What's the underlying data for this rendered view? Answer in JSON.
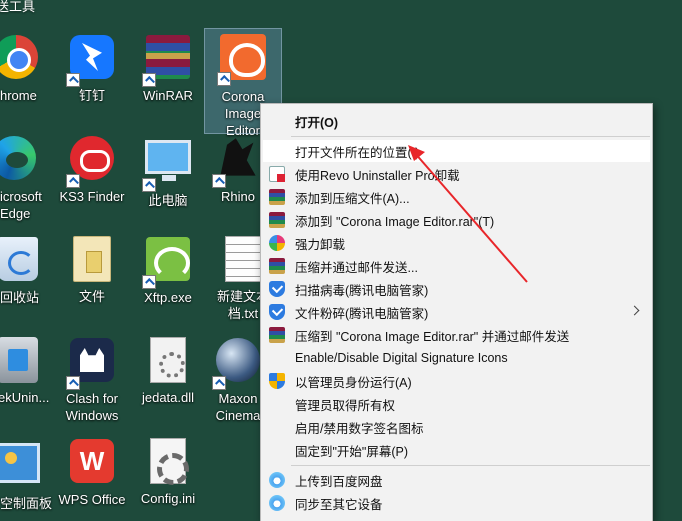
{
  "desktop": {
    "top_strip_label": "送工具",
    "icons": [
      {
        "label": "hrome",
        "icon": "chrome-icon"
      },
      {
        "label": "钉钉",
        "icon": "dingtalk-icon"
      },
      {
        "label": "WinRAR",
        "icon": "winrar-icon"
      },
      {
        "label": "Corona\nImage\nEditor",
        "icon": "corona-image-editor-icon"
      },
      {
        "label": "icrosoft\nEdge",
        "icon": "edge-icon"
      },
      {
        "label": "KS3 Finder",
        "icon": "ks3-finder-icon"
      },
      {
        "label": "此电脑",
        "icon": "this-pc-icon"
      },
      {
        "label": "Rhino",
        "icon": "rhino-icon"
      },
      {
        "label": "回收站",
        "icon": "recycle-bin-icon"
      },
      {
        "label": "文件",
        "icon": "folder-file-icon"
      },
      {
        "label": "Xftp.exe",
        "icon": "xftp-icon"
      },
      {
        "label": "新建文本\n档.txt",
        "icon": "text-file-icon"
      },
      {
        "label": "ekUnin...",
        "icon": "geek-uninstaller-icon"
      },
      {
        "label": "Clash for\nWindows",
        "icon": "clash-for-windows-icon"
      },
      {
        "label": "jedata.dll",
        "icon": "dll-file-icon"
      },
      {
        "label": "Maxon\nCinema",
        "icon": "maxon-cinema-icon"
      },
      {
        "label": "空制面板",
        "icon": "control-panel-icon"
      },
      {
        "label": "WPS Office",
        "icon": "wps-office-icon"
      },
      {
        "label": "Config.ini",
        "icon": "config-ini-icon"
      }
    ]
  },
  "context_menu": {
    "items": [
      {
        "label": "打开(O)",
        "icon": ""
      },
      {
        "label": "打开文件所在的位置(I)",
        "icon": ""
      },
      {
        "label": "使用Revo Uninstaller Pro卸载",
        "icon": "revo-uninstaller-icon"
      },
      {
        "label": "添加到压缩文件(A)...",
        "icon": "winrar-icon"
      },
      {
        "label": "添加到 \"Corona Image Editor.rar\"(T)",
        "icon": "winrar-icon"
      },
      {
        "label": "强力卸载",
        "icon": "uninstall-flower-icon"
      },
      {
        "label": "压缩并通过邮件发送...",
        "icon": "winrar-icon"
      },
      {
        "label": "扫描病毒(腾讯电脑管家)",
        "icon": "tencent-pc-manager-icon"
      },
      {
        "label": "文件粉碎(腾讯电脑管家)",
        "icon": "tencent-pc-manager-icon"
      },
      {
        "label": "压缩到 \"Corona Image Editor.rar\" 并通过邮件发送",
        "icon": "winrar-icon"
      },
      {
        "label": "Enable/Disable Digital Signature Icons",
        "icon": ""
      },
      {
        "label": "以管理员身份运行(A)",
        "icon": "uac-shield-icon"
      },
      {
        "label": "管理员取得所有权",
        "icon": ""
      },
      {
        "label": "启用/禁用数字签名图标",
        "icon": ""
      },
      {
        "label": "固定到\"开始\"屏幕(P)",
        "icon": ""
      },
      {
        "label": "上传到百度网盘",
        "icon": "baidu-netdisk-icon"
      },
      {
        "label": "同步至其它设备",
        "icon": "baidu-netdisk-icon"
      }
    ],
    "hovered_item": "打开文件所在的位置(I)"
  },
  "colors": {
    "desktop_background": "#1e4a3b",
    "menu_background": "#f2f2f2",
    "annotation_arrow": "#e8262a"
  }
}
